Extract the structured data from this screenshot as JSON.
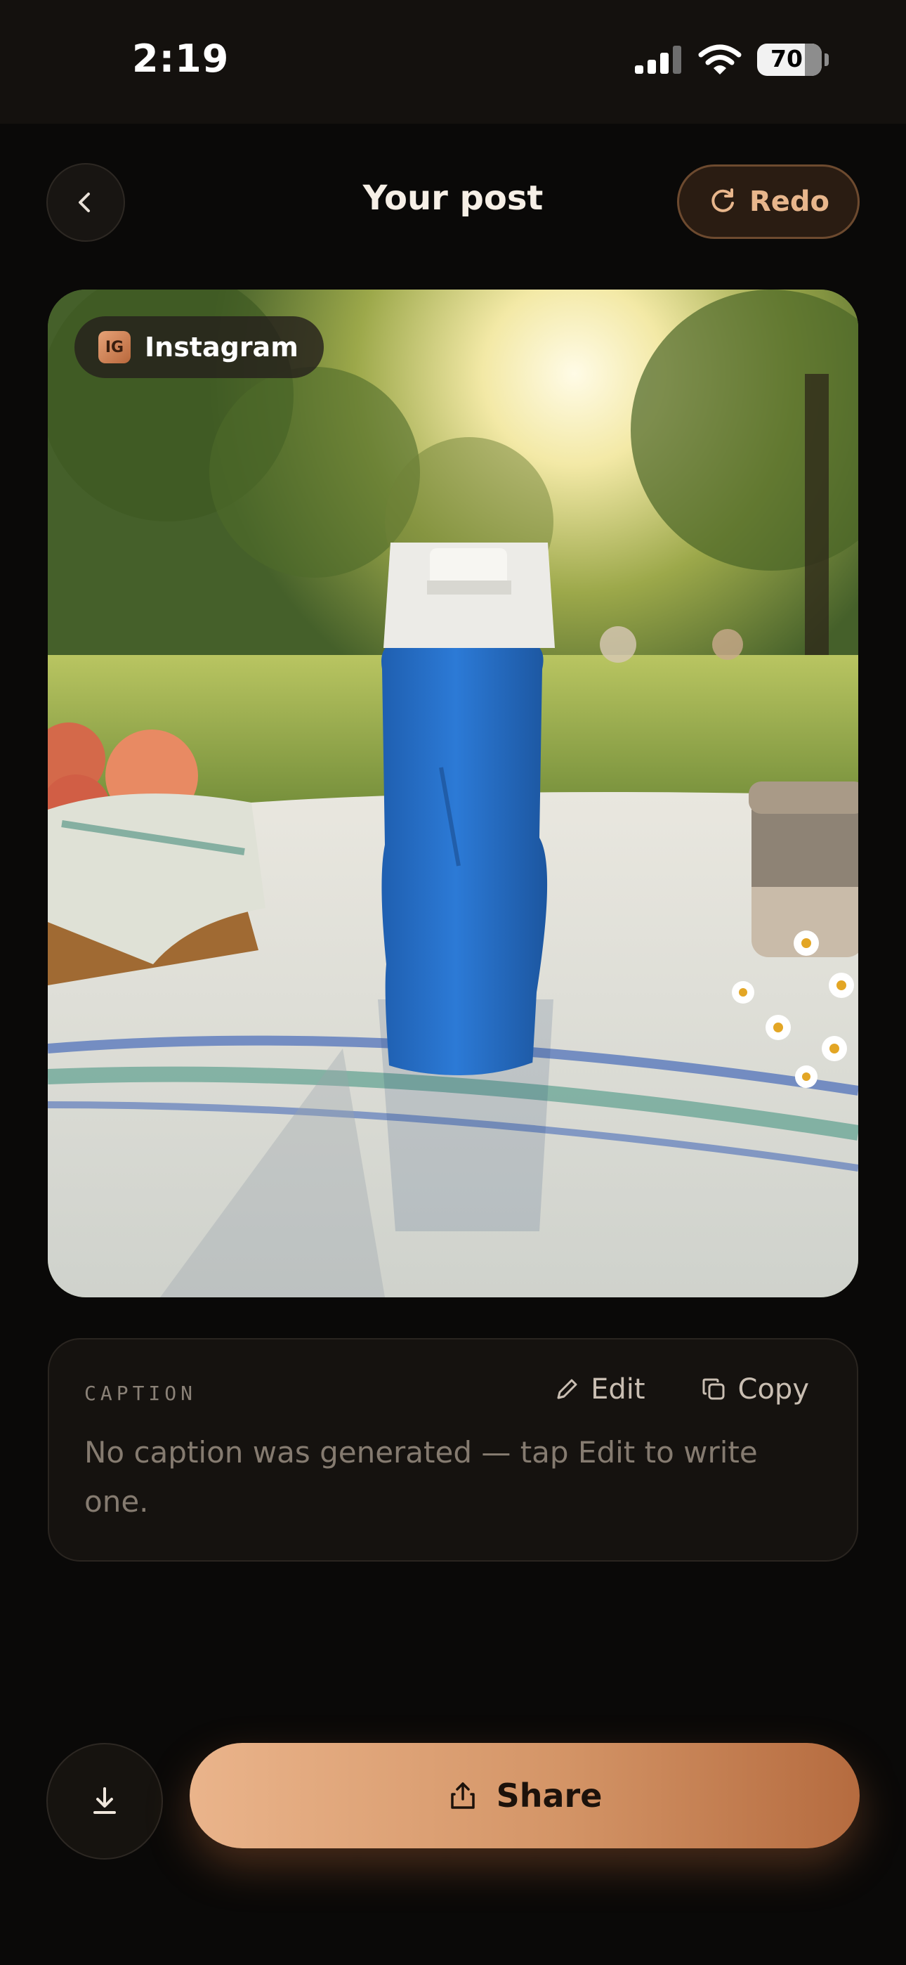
{
  "status_bar": {
    "time": "2:19",
    "battery": "70"
  },
  "header": {
    "title": "Your post",
    "redo_label": "Redo"
  },
  "post": {
    "platform_badge": "IG",
    "platform_label": "Instagram"
  },
  "caption": {
    "label": "CAPTION",
    "edit_label": "Edit",
    "copy_label": "Copy",
    "text": "No caption was generated — tap Edit to write one."
  },
  "actions": {
    "share_label": "Share"
  },
  "icons": [
    "back-chevron-icon",
    "redo-icon",
    "instagram-icon",
    "edit-pencil-icon",
    "copy-icon",
    "download-icon",
    "share-icon",
    "signal-icon",
    "wifi-icon",
    "battery-icon"
  ],
  "colors": {
    "accent": "#d49567",
    "background": "#0a0908",
    "card": "#15120f"
  }
}
